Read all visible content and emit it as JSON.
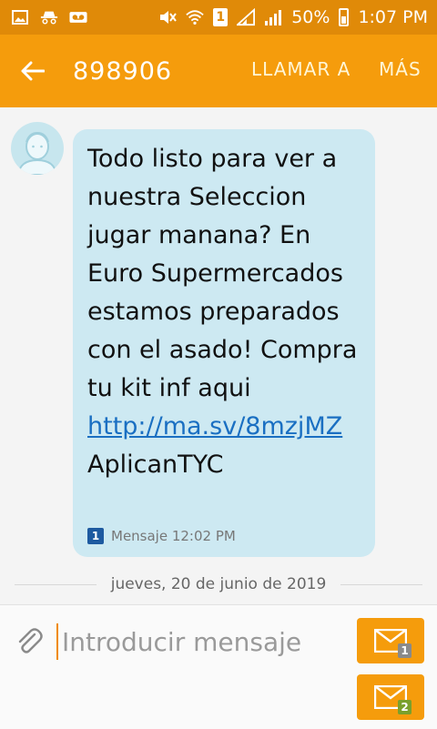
{
  "status_bar": {
    "battery_percent": "50%",
    "time": "1:07 PM",
    "sim_slot": "1",
    "icons": [
      "image-icon",
      "incognito-icon",
      "voicemail-icon",
      "mute-icon",
      "wifi-icon",
      "sim-icon",
      "signal-icon",
      "signal-icon",
      "battery-icon"
    ]
  },
  "app_bar": {
    "contact": "898906",
    "call_label": "LLAMAR A",
    "more_label": "MÁS"
  },
  "message": {
    "text": "Todo listo para ver a nuestra Seleccion jugar manana? En Euro Supermercados estamos preparados con el asado! Compra tu kit inf aqui ",
    "link": "http://ma.sv/8mzjMZ",
    "suffix": " AplicanTYC",
    "sim": "1",
    "meta": "Mensaje 12:02 PM"
  },
  "date_divider": "jueves, 20 de junio de 2019",
  "composer": {
    "placeholder": "Introducir mensaje",
    "send_sim1": "1",
    "send_sim2": "2"
  },
  "colors": {
    "status_bar": "#e08a08",
    "app_bar": "#f59c0c",
    "bubble": "#cde9f2",
    "link": "#1a6fc2"
  }
}
